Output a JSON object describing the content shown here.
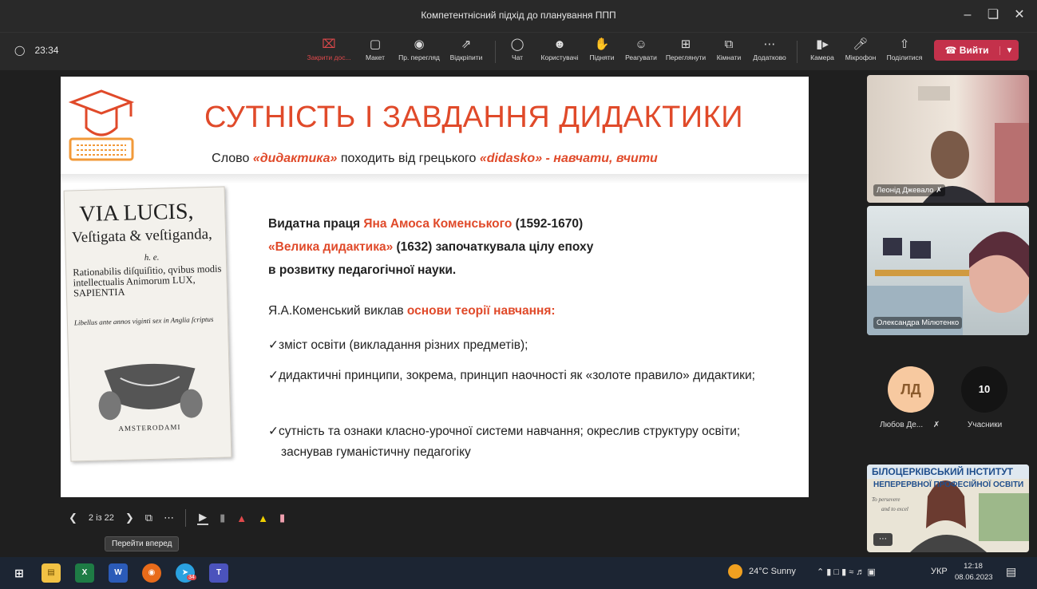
{
  "window": {
    "title": "Компетентнісний підхід до планування ППП"
  },
  "toolbar": {
    "timer": "23:34",
    "buttons": [
      {
        "label": "Закрити дос...",
        "icon": "close-share-icon"
      },
      {
        "label": "Макет",
        "icon": "layout-icon"
      },
      {
        "label": "Пр. перегляд",
        "icon": "eye-icon"
      },
      {
        "label": "Відкріпити",
        "icon": "popout-icon"
      },
      {
        "label": "Чат",
        "icon": "chat-icon"
      },
      {
        "label": "Користувачі",
        "icon": "people-icon"
      },
      {
        "label": "Підняти",
        "icon": "raise-hand-icon"
      },
      {
        "label": "Реагувати",
        "icon": "emoji-icon"
      },
      {
        "label": "Переглянути",
        "icon": "grid-icon"
      },
      {
        "label": "Кімнати",
        "icon": "rooms-icon"
      },
      {
        "label": "Додатково",
        "icon": "more-icon"
      },
      {
        "label": "Камера",
        "icon": "camera-icon"
      },
      {
        "label": "Мікрофон",
        "icon": "mic-icon"
      },
      {
        "label": "Поділитися",
        "icon": "share-icon"
      }
    ],
    "leave_label": "Вийти"
  },
  "slide": {
    "heading": "СУТНІСТЬ І ЗАВДАННЯ ДИДАКТИКИ",
    "sub_pre": "Слово ",
    "sub_word": "«дидактика»",
    "sub_mid": " походить від грецького ",
    "sub_origin": "«didasko» - навчати, вчити",
    "p1_a": "Видатна праця ",
    "p1_b": "Яна Амоса Коменського",
    "p1_c": " (1592-1670)",
    "p2_a": "«Велика дидактика»",
    "p2_b": " (1632) започаткувала цілу епоху",
    "p3": "в розвитку педагогічної науки.",
    "p4_a": "Я.А.Коменський виклав ",
    "p4_b": "основи теорії навчання:",
    "bullets": [
      "зміст освіти (викладання різних предметів);",
      "дидактичні принципи, зокрема, принцип наочності як «золоте правило» дидактики;",
      "сутність та ознаки класно-урочної системи навчання; окреслив структуру освіти; заснував гуманістичну педагогіку"
    ],
    "book": {
      "line1": "VIA LUCIS,",
      "line2": "Veſtigata & veſtiganda,",
      "line3": "h. e.",
      "line4": "Rationabilis diſquiſitio, qvibus modis intellectualis Animorum LUX, SAPIENTIA",
      "line5": "Libellus ante annos viginti sex in Anglia ſcriptus",
      "line6": "AMSTERODAMI"
    }
  },
  "participants": {
    "tile1_name": "Леонід Джевало",
    "tile2_name": "Олександра Мілютенко",
    "avatar_initials": "ЛД",
    "avatar_name": "Любов Де...",
    "count": "10",
    "count_label": "Учасники",
    "banner_line1": "БІЛОЦЕРКІВСЬКИЙ ІНСТИТУТ",
    "banner_line2": "НЕПЕРЕРВНОЇ ПРОФЕСІЙНОЇ ОСВІТИ",
    "banner_small1": "To persevere",
    "banner_small2": "and to excel"
  },
  "presenter": {
    "page": "2 із 22",
    "tooltip": "Перейти вперед"
  },
  "taskbar": {
    "weather": "24°C  Sunny",
    "lang": "УКР",
    "time": "12:18",
    "date": "08.06.2023",
    "badge": "34"
  }
}
